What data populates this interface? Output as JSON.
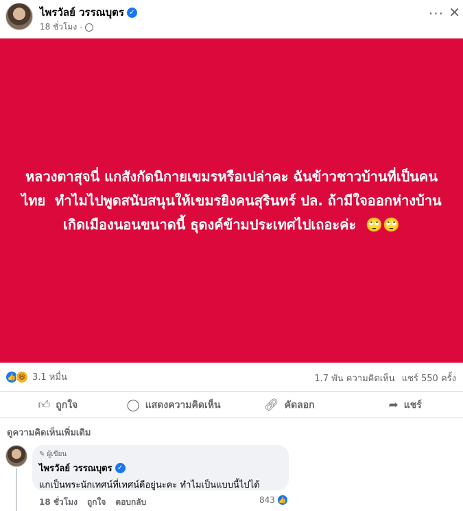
{
  "post": {
    "author": "ไพรวัลย์ วรรณบุตร",
    "time": "18 ชั่วโมง",
    "separator": "·",
    "text": "หลวงตาสุจนี่ แกสังกัดนิกายเขมรหรือเปล่าคะ ฉันข้าวชาวบ้านที่เป็นคนไทย ￼￼ ทำไมไปพูดสนับสนุนให้เขมรยิงคนสุรินทร์ ปล. ถ้ามีใจออกห่างบ้านเกิดเมืองนอนขนาดนี้ ธุดงค์ข้ามประเทศไปเถอะค่ะ ￼ 🙄🙄",
    "image_bg": "#dc0a3c"
  },
  "stats": {
    "reactions": "3.1 หมื่น",
    "comments": "1.7 พัน ความคิดเห็น",
    "shares": "แชร์ 550 ครั้ง"
  },
  "actions": {
    "like": "ถูกใจ",
    "comment": "แสดงความคิดเห็น",
    "copy": "คัดลอก",
    "share": "แชร์"
  },
  "comments_section": {
    "view_more": "ดูความคิดเห็นเพิ่มเติม",
    "comment": {
      "badge": "ผู้เขียน",
      "author": "ไพรวัลย์ วรรณบุตร",
      "text": "แกเป็นพระนักเทศน์ที่เทศน์ดีอยู่นะคะ ทำไมเป็นแบบนี้ไปได้",
      "time": "18 ชั่วโมง",
      "like": "ถูกใจ",
      "reply": "ตอบกลับ",
      "likes": "843"
    }
  },
  "colors": {
    "accent": "#1877f2",
    "secondary_text": "#65676b"
  },
  "icons": {
    "verified": "verified-badge-icon",
    "globe": "globe-icon",
    "more": "more-options-icon",
    "close": "close-icon",
    "like": "thumbs-up-icon",
    "comment": "comment-icon",
    "copy": "link-icon",
    "share": "share-icon",
    "pencil": "pencil-icon"
  }
}
